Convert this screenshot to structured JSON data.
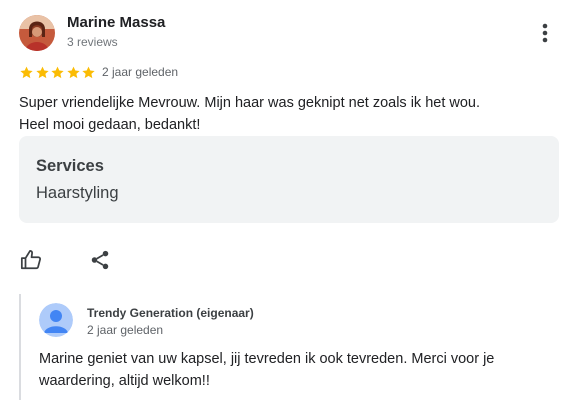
{
  "review": {
    "author": {
      "name": "Marine Massa",
      "meta": "3 reviews"
    },
    "rating": {
      "stars": 5,
      "max": 5,
      "star_color": "#fbbc04"
    },
    "date": "2 jaar geleden",
    "text_lines": [
      "Super vriendelijke Mevrouw. Mijn haar was geknipt net zoals ik het wou.",
      "Heel mooi gedaan, bedankt!"
    ],
    "services": {
      "title": "Services",
      "value": "Haarstyling"
    },
    "actions": {
      "like_icon": "thumbs-up-icon",
      "share_icon": "share-icon",
      "more_icon": "more-vert-icon"
    }
  },
  "owner_response": {
    "name": "Trendy Generation (eigenaar)",
    "date": "2 jaar geleden",
    "avatar_color": "#4285f4",
    "text_lines": [
      "Marine geniet van uw kapsel, jij tevreden ik ook tevreden. Merci voor je",
      "waardering, altijd welkom!!"
    ]
  }
}
